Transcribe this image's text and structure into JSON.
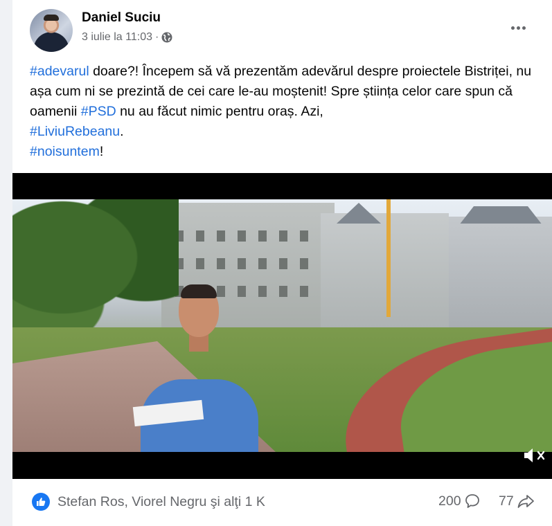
{
  "post": {
    "author": "Daniel Suciu",
    "timestamp": "3 iulie la 11:03",
    "separator": "·",
    "privacy_icon": "globe-icon",
    "more_icon": "more-options-icon",
    "text": {
      "line1_tag": "#adevarul",
      "line1_rest": " doare?! Începem să vă prezentăm adevărul despre proiectele Bistriței, nu așa cum ni se prezintă de cei care le-au moștenit! Spre știința celor care spun că oamenii ",
      "tag_psd": "#PSD",
      "line_after_psd": " nu au făcut nimic pentru oraș. Azi, ",
      "tag_liviu": "#LiviuRebeanu",
      "after_liviu": ".",
      "tag_noi": "#noisuntem",
      "after_noi": "!"
    }
  },
  "video": {
    "mute_icon": "volume-muted-icon"
  },
  "footer": {
    "like_icon": "like-icon",
    "reactors": "Stefan Ros, Viorel Negru şi alţi 1 K",
    "comments_count": "200",
    "comment_icon": "comment-icon",
    "shares_count": "77",
    "share_icon": "share-icon"
  },
  "colors": {
    "link": "#216fdb",
    "like_blue": "#1877f2",
    "secondary_text": "#65676b"
  }
}
